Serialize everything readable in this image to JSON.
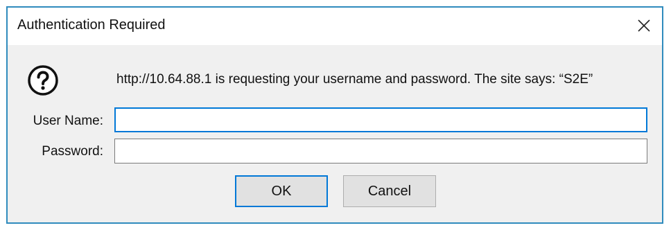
{
  "dialog": {
    "title": "Authentication Required",
    "close_icon": "close-icon",
    "prompt_icon": "question-mark-icon",
    "message": "http://10.64.88.1 is requesting your username and password. The site says: “S2E”",
    "username": {
      "label": "User Name:",
      "value": ""
    },
    "password": {
      "label": "Password:",
      "value": ""
    },
    "ok_label": "OK",
    "cancel_label": "Cancel"
  },
  "colors": {
    "border": "#2f8bbd",
    "focus": "#0078d7",
    "body_bg": "#f0f0f0",
    "button_bg": "#e1e1e1"
  }
}
